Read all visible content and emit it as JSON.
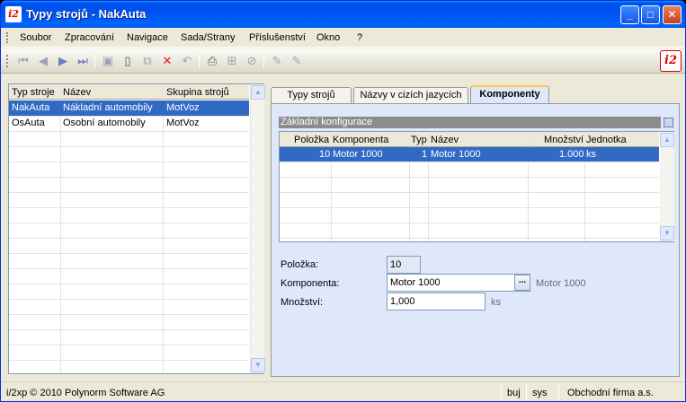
{
  "window": {
    "title": "Typy strojů - NakAuta"
  },
  "menu": [
    "Soubor",
    "Zpracování",
    "Navigace",
    "Sada/Strany",
    "Příslušenství",
    "Okno",
    "?"
  ],
  "toolbar_icons": [
    "first-icon",
    "prev-icon",
    "next-icon",
    "last-icon",
    "save-icon",
    "new-icon",
    "copy-icon",
    "delete-icon",
    "undo-icon",
    "print-icon",
    "tree-icon",
    "cancel-icon",
    "edit-icon",
    "edit2-icon"
  ],
  "left_grid": {
    "columns": [
      "Typ stroje",
      "Název",
      "Skupina strojů"
    ],
    "rows": [
      {
        "type": "NakAuta",
        "name": "Nákladní automobily",
        "group": "MotVoz",
        "selected": true
      },
      {
        "type": "OsAuta",
        "name": "Osobní automobily",
        "group": "MotVoz",
        "selected": false
      }
    ]
  },
  "tabs": [
    {
      "label": "Typy strojů",
      "active": false
    },
    {
      "label": "Názvy v cizích jazycích",
      "active": false
    },
    {
      "label": "Komponenty",
      "active": true
    }
  ],
  "section": {
    "title": "Základní konfigurace"
  },
  "components_grid": {
    "columns": [
      "Položka",
      "Komponenta",
      "Typ",
      "Název",
      "Množství",
      "Jednotka"
    ],
    "rows": [
      {
        "item": "10",
        "component": "Motor 1000",
        "type": "1",
        "name": "Motor 1000",
        "qty": "1.000",
        "unit": "ks"
      }
    ]
  },
  "form": {
    "item_label": "Položka:",
    "item_value": "10",
    "component_label": "Komponenta:",
    "component_value": "Motor 1000",
    "component_hint": "Motor 1000",
    "browse": "...",
    "qty_label": "Množství:",
    "qty_value": "1,000",
    "qty_unit": "ks"
  },
  "status": {
    "copyright": "i/2xp © 2010 Polynorm Software AG",
    "user": "buj",
    "db": "sys",
    "company": "Obchodní firma a.s."
  },
  "colors": {
    "selection": "#316ac5",
    "title_blue": "#0053ee",
    "panel": "#dfe7fb"
  }
}
